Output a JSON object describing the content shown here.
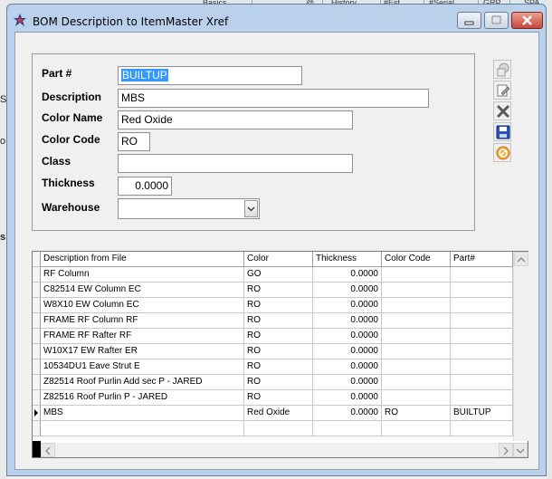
{
  "background": {
    "tabs": [
      "Basics",
      "@",
      "History",
      "#Est",
      "#Serial",
      "GRP",
      "SPA"
    ],
    "left_fragments": [
      "S",
      "o",
      "s"
    ]
  },
  "window": {
    "title": "BOM Description to ItemMaster Xref"
  },
  "form": {
    "part_label": "Part #",
    "part_value": "BUILTUP",
    "description_label": "Description",
    "description_value": "MBS",
    "color_name_label": "Color Name",
    "color_name_value": "Red Oxide",
    "color_code_label": "Color Code",
    "color_code_value": "RO",
    "class_label": "Class",
    "class_value": "",
    "thickness_label": "Thickness",
    "thickness_value": "0.0000",
    "warehouse_label": "Warehouse",
    "warehouse_value": ""
  },
  "toolbar": {
    "icons": [
      "copy-icon",
      "edit-icon",
      "delete-icon",
      "save-icon",
      "cancel-icon"
    ]
  },
  "grid": {
    "columns": [
      "Description from File",
      "Color",
      "Thickness",
      "Color Code",
      "Part#"
    ],
    "rows": [
      [
        "RF Column",
        "GO",
        "0.0000",
        "",
        ""
      ],
      [
        "C82514 EW Column EC",
        "RO",
        "0.0000",
        "",
        ""
      ],
      [
        "W8X10 EW Column EC",
        "RO",
        "0.0000",
        "",
        ""
      ],
      [
        "FRAME RF Column RF",
        "RO",
        "0.0000",
        "",
        ""
      ],
      [
        "FRAME RF Rafter RF",
        "RO",
        "0.0000",
        "",
        ""
      ],
      [
        "W10X17 EW Rafter ER",
        "RO",
        "0.0000",
        "",
        ""
      ],
      [
        "10534DU1 Eave Strut E",
        "RO",
        "0.0000",
        "",
        ""
      ],
      [
        "Z82514 Roof Purlin Add sec P - JARED",
        "RO",
        "0.0000",
        "",
        ""
      ],
      [
        "Z82516 Roof Purlin P - JARED",
        "RO",
        "0.0000",
        "",
        ""
      ],
      [
        "MBS",
        "Red Oxide",
        "0.0000",
        "RO",
        "BUILTUP"
      ]
    ],
    "current_row_index": 9
  }
}
